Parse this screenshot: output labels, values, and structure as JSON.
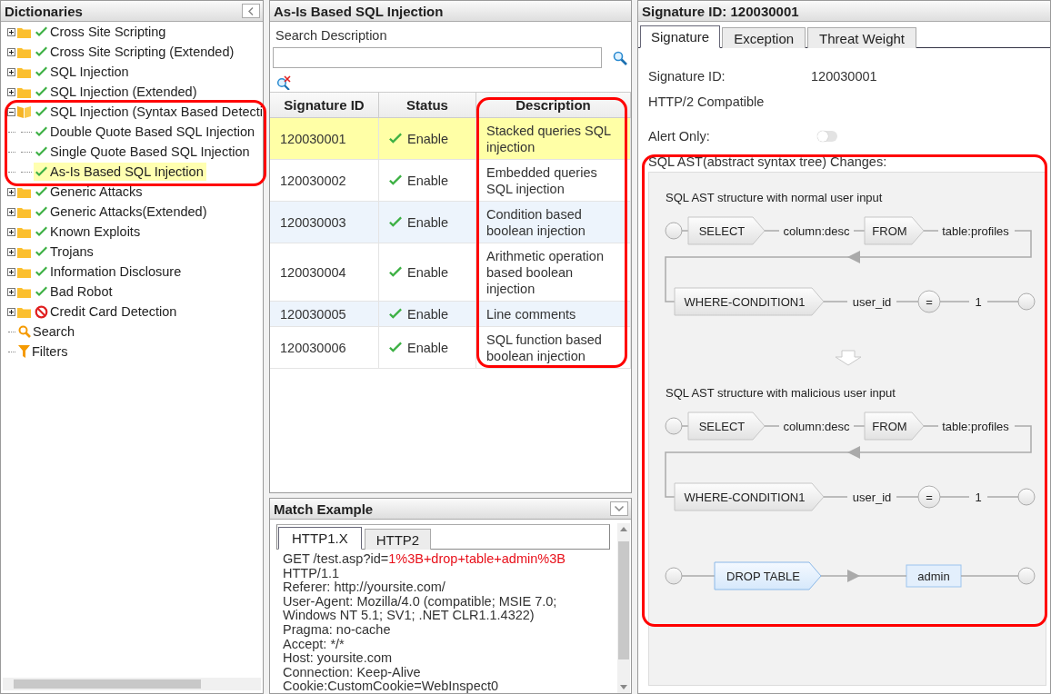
{
  "dictionaries": {
    "title": "Dictionaries",
    "items": [
      {
        "label": "Cross Site Scripting",
        "kind": "folder",
        "enabled": true,
        "expanded": false,
        "selected": false
      },
      {
        "label": "Cross Site Scripting (Extended)",
        "kind": "folder",
        "enabled": true,
        "expanded": false,
        "selected": false
      },
      {
        "label": "SQL Injection",
        "kind": "folder",
        "enabled": true,
        "expanded": false,
        "selected": false
      },
      {
        "label": "SQL Injection (Extended)",
        "kind": "folder",
        "enabled": true,
        "expanded": false,
        "selected": false
      },
      {
        "label": "SQL Injection (Syntax Based Detecti",
        "kind": "folder",
        "enabled": true,
        "expanded": true,
        "selected": false,
        "children": [
          {
            "label": "Double Quote Based SQL Injection",
            "kind": "signature",
            "enabled": true,
            "selected": false
          },
          {
            "label": "Single Quote Based SQL Injection",
            "kind": "signature",
            "enabled": true,
            "selected": false
          },
          {
            "label": "As-Is Based SQL Injection",
            "kind": "signature",
            "enabled": true,
            "selected": true
          }
        ]
      },
      {
        "label": "Generic Attacks",
        "kind": "folder",
        "enabled": true,
        "expanded": false,
        "selected": false
      },
      {
        "label": "Generic Attacks(Extended)",
        "kind": "folder",
        "enabled": true,
        "expanded": false,
        "selected": false
      },
      {
        "label": "Known Exploits",
        "kind": "folder",
        "enabled": true,
        "expanded": false,
        "selected": false
      },
      {
        "label": "Trojans",
        "kind": "folder",
        "enabled": true,
        "expanded": false,
        "selected": false
      },
      {
        "label": "Information Disclosure",
        "kind": "folder",
        "enabled": true,
        "expanded": false,
        "selected": false
      },
      {
        "label": "Bad Robot",
        "kind": "folder",
        "enabled": true,
        "expanded": false,
        "selected": false
      },
      {
        "label": "Credit Card Detection",
        "kind": "folder",
        "enabled": false,
        "expanded": false,
        "selected": false
      },
      {
        "label": "Search",
        "kind": "search",
        "selected": false
      },
      {
        "label": "Filters",
        "kind": "filter",
        "selected": false
      }
    ]
  },
  "signature_list": {
    "title": "As-Is Based SQL Injection",
    "search_label": "Search Description",
    "columns": [
      "Signature ID",
      "Status",
      "Description"
    ],
    "rows": [
      {
        "id": "120030001",
        "status": "Enable",
        "enabled": true,
        "description": "Stacked queries SQL injection",
        "selected": true
      },
      {
        "id": "120030002",
        "status": "Enable",
        "enabled": true,
        "description": "Embedded queries SQL injection",
        "selected": false
      },
      {
        "id": "120030003",
        "status": "Enable",
        "enabled": true,
        "description": "Condition based boolean injection",
        "selected": false
      },
      {
        "id": "120030004",
        "status": "Enable",
        "enabled": true,
        "description": "Arithmetic operation based boolean injection",
        "selected": false
      },
      {
        "id": "120030005",
        "status": "Enable",
        "enabled": true,
        "description": "Line comments",
        "selected": false
      },
      {
        "id": "120030006",
        "status": "Enable",
        "enabled": true,
        "description": "SQL function based boolean injection",
        "selected": false
      }
    ]
  },
  "match_example": {
    "title": "Match Example",
    "tabs": [
      {
        "label": "HTTP1.X",
        "selected": true
      },
      {
        "label": "HTTP2",
        "selected": false
      }
    ],
    "request": {
      "request_line": "GET /test.asp?id=",
      "payload": "1%3B+drop+table+admin%3B",
      "lines": [
        "HTTP/1.1",
        "Referer: http://yoursite.com/",
        "User-Agent: Mozilla/4.0 (compatible; MSIE 7.0;",
        "Windows NT 5.1; SV1; .NET CLR1.1.4322)",
        "Pragma: no-cache",
        "Accept: */*",
        "Host: yoursite.com",
        "Connection: Keep-Alive",
        "Cookie:CustomCookie=WebInspect0"
      ]
    }
  },
  "signature_detail": {
    "title": "Signature ID: 120030001",
    "tabs": [
      {
        "label": "Signature",
        "selected": true
      },
      {
        "label": "Exception",
        "selected": false
      },
      {
        "label": "Threat Weight",
        "selected": false
      }
    ],
    "fields": [
      {
        "label": "Signature ID:",
        "value": "120030001"
      },
      {
        "label": "HTTP/2 Compatible"
      }
    ],
    "alert_only": {
      "label": "Alert Only:",
      "on": false
    },
    "ast": {
      "label": "SQL AST(abstract syntax tree) Changes:",
      "sections": [
        {
          "caption": "SQL AST structure with normal user input",
          "nodes": [
            {
              "kind": "keyword",
              "label": "SELECT"
            },
            {
              "kind": "field",
              "label": "column:desc"
            },
            {
              "kind": "keyword",
              "label": "FROM"
            },
            {
              "kind": "field",
              "label": "table:profiles"
            },
            {
              "kind": "keyword",
              "label": "WHERE-CONDITION1"
            },
            {
              "kind": "field",
              "label": "user_id"
            },
            {
              "kind": "operator",
              "label": "="
            },
            {
              "kind": "field",
              "label": "1"
            }
          ]
        },
        {
          "caption": "SQL AST structure with malicious user input",
          "nodes": [
            {
              "kind": "keyword",
              "label": "SELECT"
            },
            {
              "kind": "field",
              "label": "column:desc"
            },
            {
              "kind": "keyword",
              "label": "FROM"
            },
            {
              "kind": "field",
              "label": "table:profiles"
            },
            {
              "kind": "keyword",
              "label": "WHERE-CONDITION1"
            },
            {
              "kind": "field",
              "label": "user_id"
            },
            {
              "kind": "operator",
              "label": "="
            },
            {
              "kind": "field",
              "label": "1"
            }
          ]
        }
      ],
      "injected": [
        {
          "kind": "keyword",
          "label": "DROP TABLE"
        },
        {
          "kind": "value",
          "label": "admin"
        }
      ]
    }
  }
}
